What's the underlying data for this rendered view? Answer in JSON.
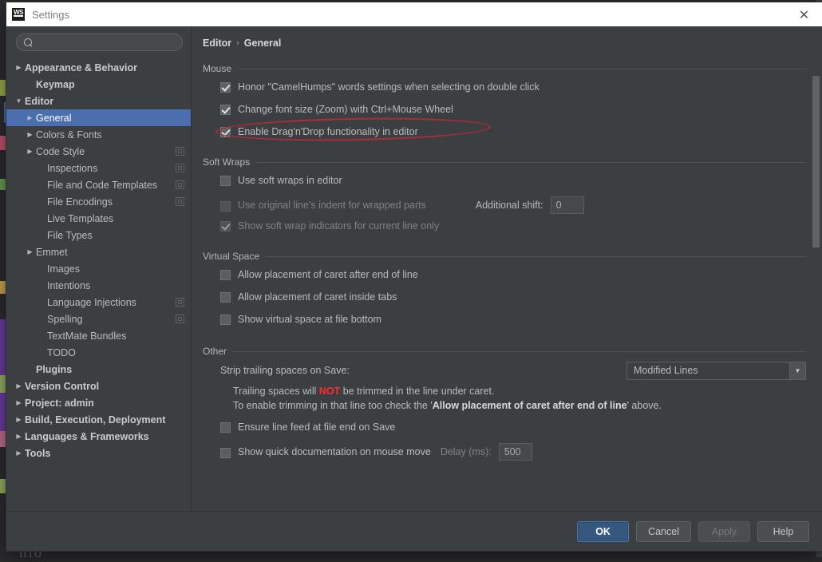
{
  "window": {
    "title": "Settings",
    "app_icon": "webstorm-icon",
    "close_icon": "close-icon"
  },
  "search": {
    "value": "",
    "placeholder": "",
    "icon": "search-icon"
  },
  "sidebar": {
    "items": [
      {
        "label": "Appearance & Behavior",
        "indent": 0,
        "arrow": "collapsed",
        "bold": true,
        "selected": false,
        "badge": false
      },
      {
        "label": "Keymap",
        "indent": 1,
        "arrow": "none",
        "bold": true,
        "selected": false,
        "badge": false
      },
      {
        "label": "Editor",
        "indent": 0,
        "arrow": "expanded",
        "bold": true,
        "selected": false,
        "badge": false
      },
      {
        "label": "General",
        "indent": 1,
        "arrow": "collapsed",
        "bold": false,
        "selected": true,
        "badge": false
      },
      {
        "label": "Colors & Fonts",
        "indent": 1,
        "arrow": "collapsed",
        "bold": false,
        "selected": false,
        "badge": false
      },
      {
        "label": "Code Style",
        "indent": 1,
        "arrow": "collapsed",
        "bold": false,
        "selected": false,
        "badge": true
      },
      {
        "label": "Inspections",
        "indent": 2,
        "arrow": "none",
        "bold": false,
        "selected": false,
        "badge": true
      },
      {
        "label": "File and Code Templates",
        "indent": 2,
        "arrow": "none",
        "bold": false,
        "selected": false,
        "badge": true
      },
      {
        "label": "File Encodings",
        "indent": 2,
        "arrow": "none",
        "bold": false,
        "selected": false,
        "badge": true
      },
      {
        "label": "Live Templates",
        "indent": 2,
        "arrow": "none",
        "bold": false,
        "selected": false,
        "badge": false
      },
      {
        "label": "File Types",
        "indent": 2,
        "arrow": "none",
        "bold": false,
        "selected": false,
        "badge": false
      },
      {
        "label": "Emmet",
        "indent": 1,
        "arrow": "collapsed",
        "bold": false,
        "selected": false,
        "badge": false
      },
      {
        "label": "Images",
        "indent": 2,
        "arrow": "none",
        "bold": false,
        "selected": false,
        "badge": false
      },
      {
        "label": "Intentions",
        "indent": 2,
        "arrow": "none",
        "bold": false,
        "selected": false,
        "badge": false
      },
      {
        "label": "Language Injections",
        "indent": 2,
        "arrow": "none",
        "bold": false,
        "selected": false,
        "badge": true
      },
      {
        "label": "Spelling",
        "indent": 2,
        "arrow": "none",
        "bold": false,
        "selected": false,
        "badge": true
      },
      {
        "label": "TextMate Bundles",
        "indent": 2,
        "arrow": "none",
        "bold": false,
        "selected": false,
        "badge": false
      },
      {
        "label": "TODO",
        "indent": 2,
        "arrow": "none",
        "bold": false,
        "selected": false,
        "badge": false
      },
      {
        "label": "Plugins",
        "indent": 1,
        "arrow": "none",
        "bold": true,
        "selected": false,
        "badge": false
      },
      {
        "label": "Version Control",
        "indent": 0,
        "arrow": "collapsed",
        "bold": true,
        "selected": false,
        "badge": false
      },
      {
        "label": "Project: admin",
        "indent": 0,
        "arrow": "collapsed",
        "bold": true,
        "selected": false,
        "badge": false
      },
      {
        "label": "Build, Execution, Deployment",
        "indent": 0,
        "arrow": "collapsed",
        "bold": true,
        "selected": false,
        "badge": false
      },
      {
        "label": "Languages & Frameworks",
        "indent": 0,
        "arrow": "collapsed",
        "bold": true,
        "selected": false,
        "badge": false
      },
      {
        "label": "Tools",
        "indent": 0,
        "arrow": "collapsed",
        "bold": true,
        "selected": false,
        "badge": false
      }
    ]
  },
  "breadcrumb": {
    "root": "Editor",
    "separator": "›",
    "leaf": "General"
  },
  "sections": {
    "mouse": {
      "title": "Mouse",
      "options": [
        {
          "label": "Honor \"CamelHumps\" words settings when selecting on double click",
          "checked": true,
          "disabled": false
        },
        {
          "label": "Change font size (Zoom) with Ctrl+Mouse Wheel",
          "checked": true,
          "disabled": false
        },
        {
          "label": "Enable Drag'n'Drop functionality in editor",
          "checked": true,
          "disabled": false
        }
      ]
    },
    "soft_wraps": {
      "title": "Soft Wraps",
      "options": [
        {
          "label": "Use soft wraps in editor",
          "checked": false,
          "disabled": false
        },
        {
          "label": "Use original line's indent for wrapped parts",
          "checked": false,
          "disabled": true
        },
        {
          "label": "Show soft wrap indicators for current line only",
          "checked": true,
          "disabled": true
        }
      ],
      "additional_shift_label": "Additional shift:",
      "additional_shift_value": "0"
    },
    "virtual_space": {
      "title": "Virtual Space",
      "options": [
        {
          "label": "Allow placement of caret after end of line",
          "checked": false,
          "disabled": false
        },
        {
          "label": "Allow placement of caret inside tabs",
          "checked": false,
          "disabled": false
        },
        {
          "label": "Show virtual space at file bottom",
          "checked": false,
          "disabled": false
        }
      ]
    },
    "other": {
      "title": "Other",
      "strip_label": "Strip trailing spaces on Save:",
      "strip_value": "Modified Lines",
      "strip_arrow_icon": "chevron-down-icon",
      "note_line1_pre": "Trailing spaces will ",
      "note_line1_red": "NOT",
      "note_line1_post": " be trimmed in the line under caret.",
      "note_line2_pre": "To enable trimming in that line too check the '",
      "note_line2_bold": "Allow placement of caret after end of line",
      "note_line2_post": "' above.",
      "options": [
        {
          "label": "Ensure line feed at file end on Save",
          "checked": false,
          "disabled": false
        },
        {
          "label": "Show quick documentation on mouse move",
          "checked": false,
          "disabled": false
        }
      ],
      "delay_label": "Delay (ms):",
      "delay_value": "500"
    }
  },
  "footer": {
    "buttons": [
      {
        "label": "OK",
        "style": "primary"
      },
      {
        "label": "Cancel",
        "style": "normal"
      },
      {
        "label": "Apply",
        "style": "disabled"
      },
      {
        "label": "Help",
        "style": "normal"
      }
    ]
  },
  "annotation": {
    "type": "red-ellipse-highlight",
    "color": "#b02a3a",
    "targets": "Change font size (Zoom) with Ctrl+Mouse Wheel"
  },
  "backdrop": {
    "bottom_text": "nio"
  }
}
